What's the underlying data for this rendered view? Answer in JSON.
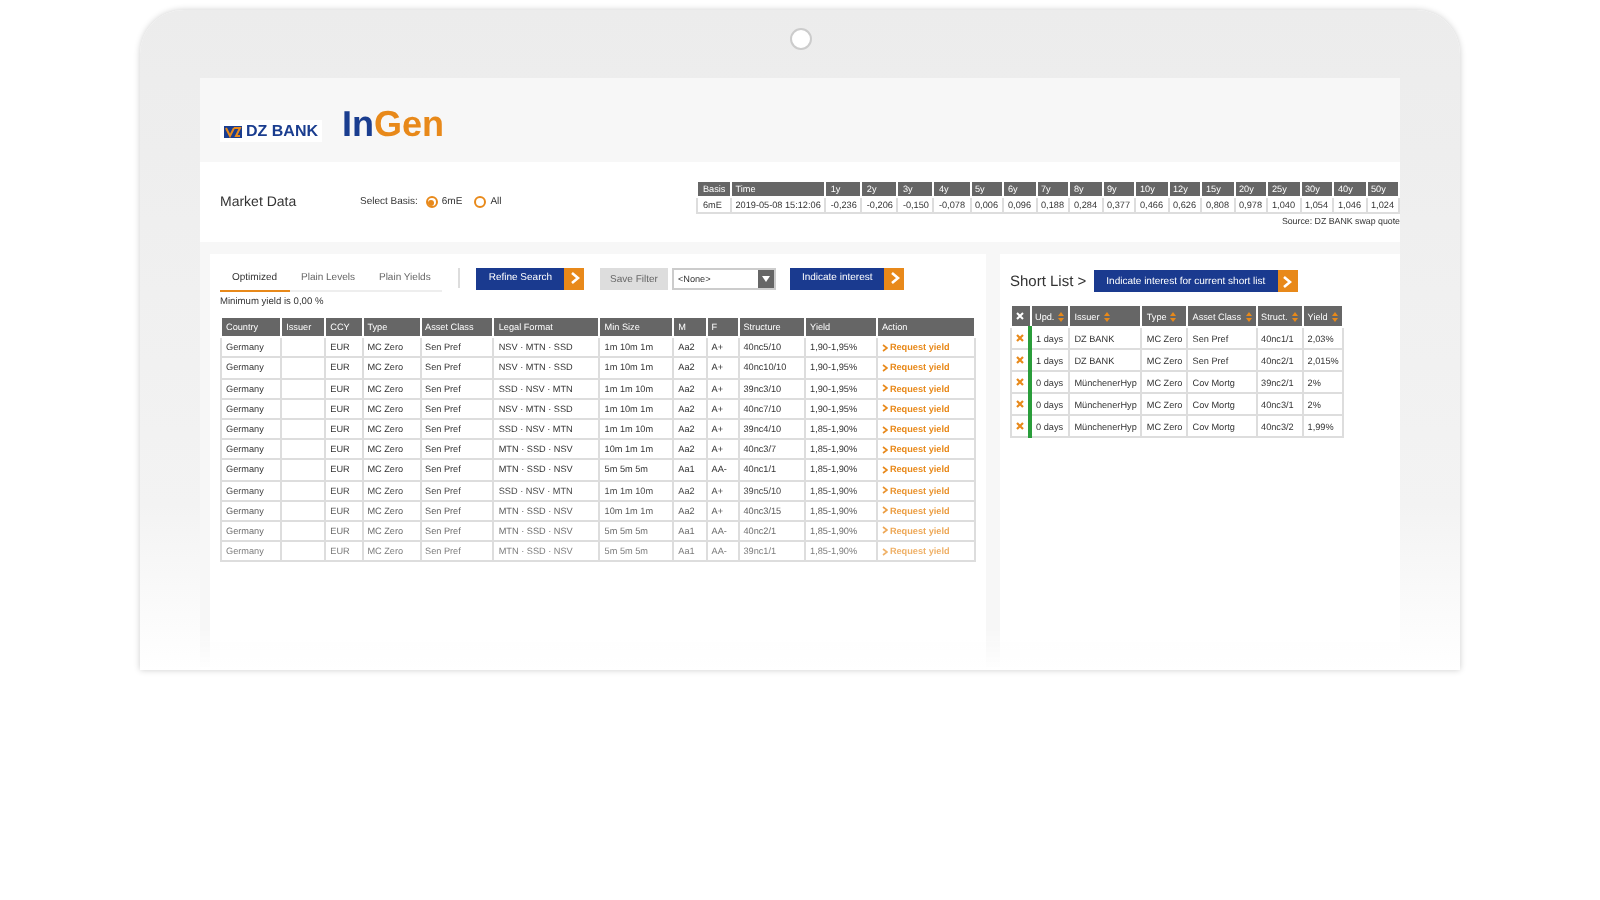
{
  "header": {
    "bank_logo": "DZ BANK",
    "app_logo_parts": [
      "In",
      "Gen"
    ]
  },
  "market_data": {
    "title": "Market Data",
    "basis_label": "Select Basis:",
    "basis_options": [
      {
        "label": "6mE",
        "selected": true
      },
      {
        "label": "All",
        "selected": false
      }
    ],
    "columns": [
      "Basis",
      "Time",
      "1y",
      "2y",
      "3y",
      "4y",
      "5y",
      "6y",
      "7y",
      "8y",
      "9y",
      "10y",
      "12y",
      "15y",
      "20y",
      "25y",
      "30y",
      "40y",
      "50y"
    ],
    "row": [
      "6mE",
      "2019-05-08 15:12:06",
      "-0,236",
      "-0,206",
      "-0,150",
      "-0,078",
      "0,006",
      "0,096",
      "0,188",
      "0,284",
      "0,377",
      "0,466",
      "0,626",
      "0,808",
      "0,978",
      "1,040",
      "1,054",
      "1,046",
      "1,024"
    ],
    "source": "Source: DZ BANK swap quote"
  },
  "search": {
    "tabs": [
      {
        "label": "Optimized",
        "selected": true
      },
      {
        "label": "Plain Levels",
        "selected": false
      },
      {
        "label": "Plain Yields",
        "selected": false
      }
    ],
    "refine_button": "Refine Search",
    "save_filter_button": "Save Filter",
    "filter_select": "<None>",
    "indicate_button": "Indicate interest",
    "minimum_yield": "Minimum yield is 0,00 %",
    "columns": [
      "Country",
      "Issuer",
      "CCY",
      "Type",
      "Asset Class",
      "Legal Format",
      "Min Size",
      "M",
      "F",
      "Structure",
      "Yield",
      "Action"
    ],
    "rows": [
      [
        "Germany",
        "",
        "EUR",
        "MC Zero",
        "Sen Pref",
        "NSV · MTN · SSD",
        "1m 10m 1m",
        "Aa2",
        "A+",
        "40nc5/10",
        "1,90-1,95%",
        "Request yield"
      ],
      [
        "Germany",
        "",
        "EUR",
        "MC Zero",
        "Sen Pref",
        "NSV · MTN · SSD",
        "1m 10m 1m",
        "Aa2",
        "A+",
        "40nc10/10",
        "1,90-1,95%",
        "Request yield"
      ],
      [
        "Germany",
        "",
        "EUR",
        "MC Zero",
        "Sen Pref",
        "SSD · NSV · MTN",
        "1m 1m 10m",
        "Aa2",
        "A+",
        "39nc3/10",
        "1,90-1,95%",
        "Request yield"
      ],
      [
        "Germany",
        "",
        "EUR",
        "MC Zero",
        "Sen Pref",
        "NSV · MTN · SSD",
        "1m 10m 1m",
        "Aa2",
        "A+",
        "40nc7/10",
        "1,90-1,95%",
        "Request yield"
      ],
      [
        "Germany",
        "",
        "EUR",
        "MC Zero",
        "Sen Pref",
        "SSD · NSV · MTN",
        "1m 1m 10m",
        "Aa2",
        "A+",
        "39nc4/10",
        "1,85-1,90%",
        "Request yield"
      ],
      [
        "Germany",
        "",
        "EUR",
        "MC Zero",
        "Sen Pref",
        "MTN · SSD · NSV",
        "10m 1m 1m",
        "Aa2",
        "A+",
        "40nc3/7",
        "1,85-1,90%",
        "Request yield"
      ],
      [
        "Germany",
        "",
        "EUR",
        "MC Zero",
        "Sen Pref",
        "MTN · SSD · NSV",
        "5m 5m 5m",
        "Aa1",
        "AA-",
        "40nc1/1",
        "1,85-1,90%",
        "Request yield"
      ],
      [
        "Germany",
        "",
        "EUR",
        "MC Zero",
        "Sen Pref",
        "SSD · NSV · MTN",
        "1m 1m 10m",
        "Aa2",
        "A+",
        "39nc5/10",
        "1,85-1,90%",
        "Request yield"
      ],
      [
        "Germany",
        "",
        "EUR",
        "MC Zero",
        "Sen Pref",
        "MTN · SSD · NSV",
        "10m 1m 1m",
        "Aa2",
        "A+",
        "40nc3/15",
        "1,85-1,90%",
        "Request yield"
      ],
      [
        "Germany",
        "",
        "EUR",
        "MC Zero",
        "Sen Pref",
        "MTN · SSD · NSV",
        "5m 5m 5m",
        "Aa1",
        "AA-",
        "40nc2/1",
        "1,85-1,90%",
        "Request yield"
      ],
      [
        "Germany",
        "",
        "EUR",
        "MC Zero",
        "Sen Pref",
        "MTN · SSD · NSV",
        "5m 5m 5m",
        "Aa1",
        "AA-",
        "39nc1/1",
        "1,85-1,90%",
        "Request yield"
      ]
    ]
  },
  "short_list": {
    "title": "Short List",
    "title_arrow": ">",
    "indicate_button": "Indicate interest for current short list",
    "columns": [
      "Upd.",
      "Issuer",
      "Type",
      "Asset Class",
      "Struct.",
      "Yield"
    ],
    "rows": [
      [
        "1 days",
        "DZ BANK",
        "MC Zero",
        "Sen Pref",
        "40nc1/1",
        "2,03%"
      ],
      [
        "1 days",
        "DZ BANK",
        "MC Zero",
        "Sen Pref",
        "40nc2/1",
        "2,015%"
      ],
      [
        "0 days",
        "MünchenerHyp",
        "MC Zero",
        "Cov Mortg",
        "39nc2/1",
        "2%"
      ],
      [
        "0 days",
        "MünchenerHyp",
        "MC Zero",
        "Cov Mortg",
        "40nc3/1",
        "2%"
      ],
      [
        "0 days",
        "MünchenerHyp",
        "MC Zero",
        "Cov Mortg",
        "40nc3/2",
        "1,99%"
      ]
    ]
  }
}
